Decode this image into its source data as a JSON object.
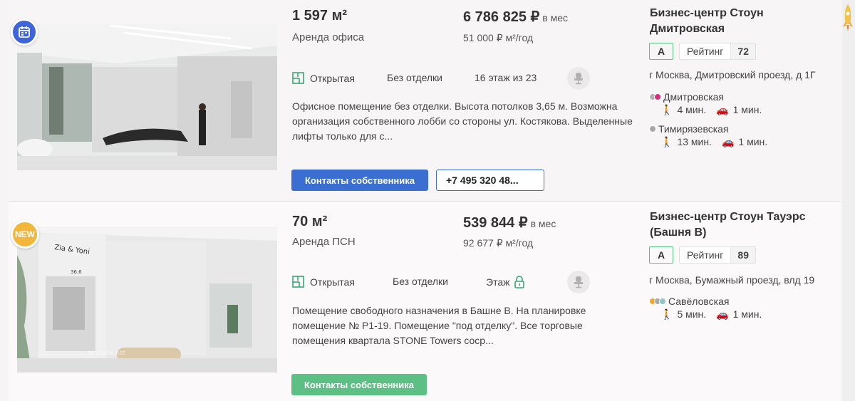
{
  "listings": [
    {
      "area": "1 597 м²",
      "deal_type": "Аренда офиса",
      "price": "6 786 825 ₽",
      "price_period": "в мес",
      "price_per_m2": "51 000 ₽ м²/год",
      "features": {
        "layout": "Открытая",
        "finish": "Без отделки",
        "floor": "16 этаж из 23"
      },
      "description": "Офисное помещение без отделки. Высота потолков 3,65 м. Возможна организация собственного лобби со стороны ул. Костякова. Выделенные лифты только для с...",
      "contact_button": "Контакты собственника",
      "phone": "+7 495 320 48...",
      "business_center": "Бизнес-центр Стоун Дмитровская",
      "class": "A",
      "rating_label": "Рейтинг",
      "rating_value": "72",
      "address": "г Москва, Дмитровский проезд, д 1Г",
      "metro": [
        {
          "station": "Дмитровская",
          "walk": "4 мин.",
          "car": "1 мин.",
          "colors": [
            "#b3b3b3",
            "#d6317d"
          ]
        },
        {
          "station": "Тимирязевская",
          "walk": "13 мин.",
          "car": "1 мин.",
          "colors": [
            "#a8a8a8"
          ]
        }
      ]
    },
    {
      "badge": "NEW",
      "area": "70 м²",
      "deal_type": "Аренда ПСН",
      "price": "539 844 ₽",
      "price_period": "в мес",
      "price_per_m2": "92 677 ₽ м²/год",
      "features": {
        "layout": "Открытая",
        "finish": "Без отделки",
        "floor": "Этаж"
      },
      "description": "Помещение свободного назначения в Башне В. На планировке помещение № Р1-19. Помещение \"под отделку\". Все торговые помещения квартала STONE Towers соср...",
      "contact_button": "Контакты собственника",
      "business_center": "Бизнес-центр Стоун Тауэрс (Башня В)",
      "class": "A",
      "rating_label": "Рейтинг",
      "rating_value": "89",
      "address": "г Москва, Бумажный проезд, влд 19",
      "metro": [
        {
          "station": "Савёловская",
          "walk": "5 мин.",
          "car": "1 мин.",
          "colors": [
            "#f2a52e",
            "#a9a9a9",
            "#8fc7c2"
          ]
        }
      ]
    }
  ],
  "photo_text": {
    "sign_left": "Zia & Yoni",
    "room_number": "36.6",
    "watermark": "m2data.net"
  },
  "colors": {
    "primary_button": "#3a6fd1",
    "contact_green": "#5cbf84",
    "new_badge": "#f2b73a",
    "calendar_badge": "#3f63d8"
  }
}
